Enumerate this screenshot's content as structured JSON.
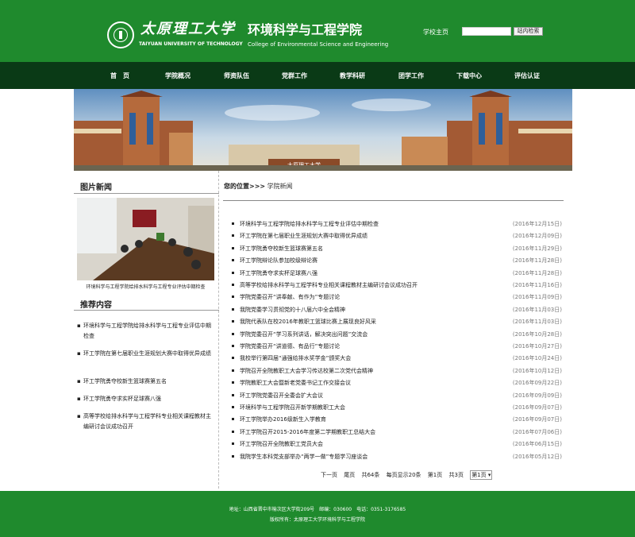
{
  "header": {
    "university_cn": "太原理工大学",
    "university_en": "TAIYUAN UNIVERSITY OF TECHNOLOGY",
    "college_cn": "环境科学与工程学院",
    "college_en": "College of Environmental Science and Engineering",
    "home_link": "学校主页",
    "search_placeholder": "",
    "search_button": "站内检索"
  },
  "nav": [
    "首　页",
    "学院概况",
    "师资队伍",
    "党群工作",
    "教学科研",
    "团学工作",
    "下载中心",
    "评估认证"
  ],
  "banner": {
    "gate_sign": "太原理工大学"
  },
  "sidebar": {
    "photo_news_title": "图片新闻",
    "photo_caption": "环境科学与工程学院给排水科学与工程专业评估中期检查",
    "recommend_title": "推荐内容",
    "recommend_items": [
      "环境科学与工程学院给排水科学与工程专业评估中期检查",
      "环工学院在第七届职业生涯规划大赛中取得优异成绩",
      "环工学院勇夺校新生篮球赛第五名",
      "环工学院勇夺求实杯足球赛八强",
      "高等学校给排水科学与工程学科专业相关课程教材主编研讨会议成功召开"
    ]
  },
  "breadcrumb": {
    "label": "您的位置>>>",
    "current": "学院新闻"
  },
  "news": [
    {
      "title": "环境科学与工程学院给排水科学与工程专业评估中期检查",
      "date": "(2016年12月15日)"
    },
    {
      "title": "环工学院在第七届职业生涯规划大赛中取得优异成绩",
      "date": "(2016年12月09日)"
    },
    {
      "title": "环工学院勇夺校新生篮球赛第五名",
      "date": "(2016年11月29日)"
    },
    {
      "title": "环工学院辩论队参加校级辩论赛",
      "date": "(2016年11月28日)"
    },
    {
      "title": "环工学院勇夺求实杯足球赛八强",
      "date": "(2016年11月28日)"
    },
    {
      "title": "高等学校给排水科学与工程学科专业相关课程教材主编研讨会议成功召开",
      "date": "(2016年11月16日)"
    },
    {
      "title": "学院党委召开“讲奉献、有作为”专题讨论",
      "date": "(2016年11月09日)"
    },
    {
      "title": "我院党委学习贯彻党的十八届六中全会精神",
      "date": "(2016年11月03日)"
    },
    {
      "title": "我院代表队在校2016年教职工篮球比赛上展现良好风采",
      "date": "(2016年11月03日)"
    },
    {
      "title": "学院党委召开“学习系列讲话，解决突出问题”交流会",
      "date": "(2016年10月28日)"
    },
    {
      "title": "学院党委召开“讲道德、有品行”专题讨论",
      "date": "(2016年10月27日)"
    },
    {
      "title": "我校举行第四届“通强给排水奖学金”颁奖大会",
      "date": "(2016年10月24日)"
    },
    {
      "title": "学院召开全院教职工大会学习传达校第二次党代会精神",
      "date": "(2016年10月12日)"
    },
    {
      "title": "学院教职工大会暨新老党委书记工作交接会议",
      "date": "(2016年09月22日)"
    },
    {
      "title": "环工学院党委召开全委会扩大会议",
      "date": "(2016年09月09日)"
    },
    {
      "title": "环境科学与工程学院召开新学期教职工大会",
      "date": "(2016年09月07日)"
    },
    {
      "title": "环工学院举办2016级新生入学教育",
      "date": "(2016年09月07日)"
    },
    {
      "title": "环工学院召开2015-2016年度第二学期教职工总结大会",
      "date": "(2016年07月06日)"
    },
    {
      "title": "环工学院召开全院教职工党员大会",
      "date": "(2016年06月15日)"
    },
    {
      "title": "我院学生本科党支部举办“两学一做”专题学习座谈会",
      "date": "(2016年05月12日)"
    }
  ],
  "pager": {
    "prev": "下一页",
    "last": "尾页",
    "total": "共64条",
    "per_page": "每页显示20条",
    "current": "第1页",
    "pages": "共3页",
    "select": "第1页 ▾"
  },
  "footer": {
    "address": "地址：山西省晋中市榆次区大学街209号　邮编：030600　电话：0351-3176585",
    "copyright": "版权所有：太原理工大学环境科学与工程学院"
  },
  "colors": {
    "header_green": "#1f8a2d",
    "nav_dark": "#0a3a16"
  }
}
